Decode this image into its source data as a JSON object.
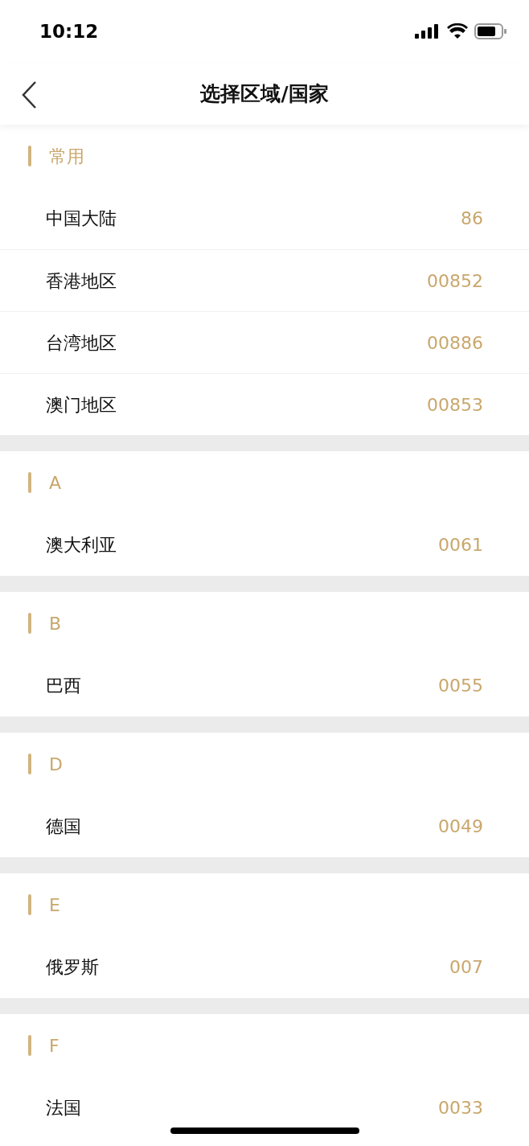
{
  "status_bar": {
    "time": "10:12"
  },
  "header": {
    "title": "选择区域/国家"
  },
  "sections": [
    {
      "title": "常用",
      "rows": [
        {
          "name": "中国大陆",
          "code": "86"
        },
        {
          "name": "香港地区",
          "code": "00852"
        },
        {
          "name": "台湾地区",
          "code": "00886"
        },
        {
          "name": "澳门地区",
          "code": "00853"
        }
      ]
    },
    {
      "title": "A",
      "rows": [
        {
          "name": "澳大利亚",
          "code": "0061"
        }
      ]
    },
    {
      "title": "B",
      "rows": [
        {
          "name": "巴西",
          "code": "0055"
        }
      ]
    },
    {
      "title": "D",
      "rows": [
        {
          "name": "德国",
          "code": "0049"
        }
      ]
    },
    {
      "title": "E",
      "rows": [
        {
          "name": "俄罗斯",
          "code": "007"
        }
      ]
    },
    {
      "title": "F",
      "rows": [
        {
          "name": "法国",
          "code": "0033"
        }
      ]
    }
  ]
}
